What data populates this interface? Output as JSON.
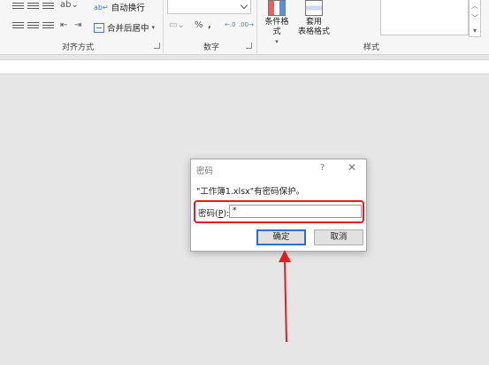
{
  "ribbon": {
    "wrap_text_label": "自动换行",
    "merge_center_label": "合并后居中",
    "alignment_group": "对齐方式",
    "number_group": "数字",
    "styles_group": "样式",
    "conditional_format_label": "条件格式",
    "table_format_line1": "套用",
    "table_format_line2": "表格格式",
    "number_format_value": "",
    "percent_symbol": "%",
    "comma_symbol": ","
  },
  "dialog": {
    "title": "密码",
    "help_symbol": "?",
    "close_symbol": "✕",
    "message": "\"工作簿1.xlsx\"有密码保护。",
    "password_label_prefix": "密码(",
    "password_label_key": "P",
    "password_label_suffix": "):",
    "password_value": "*",
    "ok_label": "确定",
    "cancel_label": "取消"
  },
  "annotation": {
    "color": "#e02020"
  }
}
